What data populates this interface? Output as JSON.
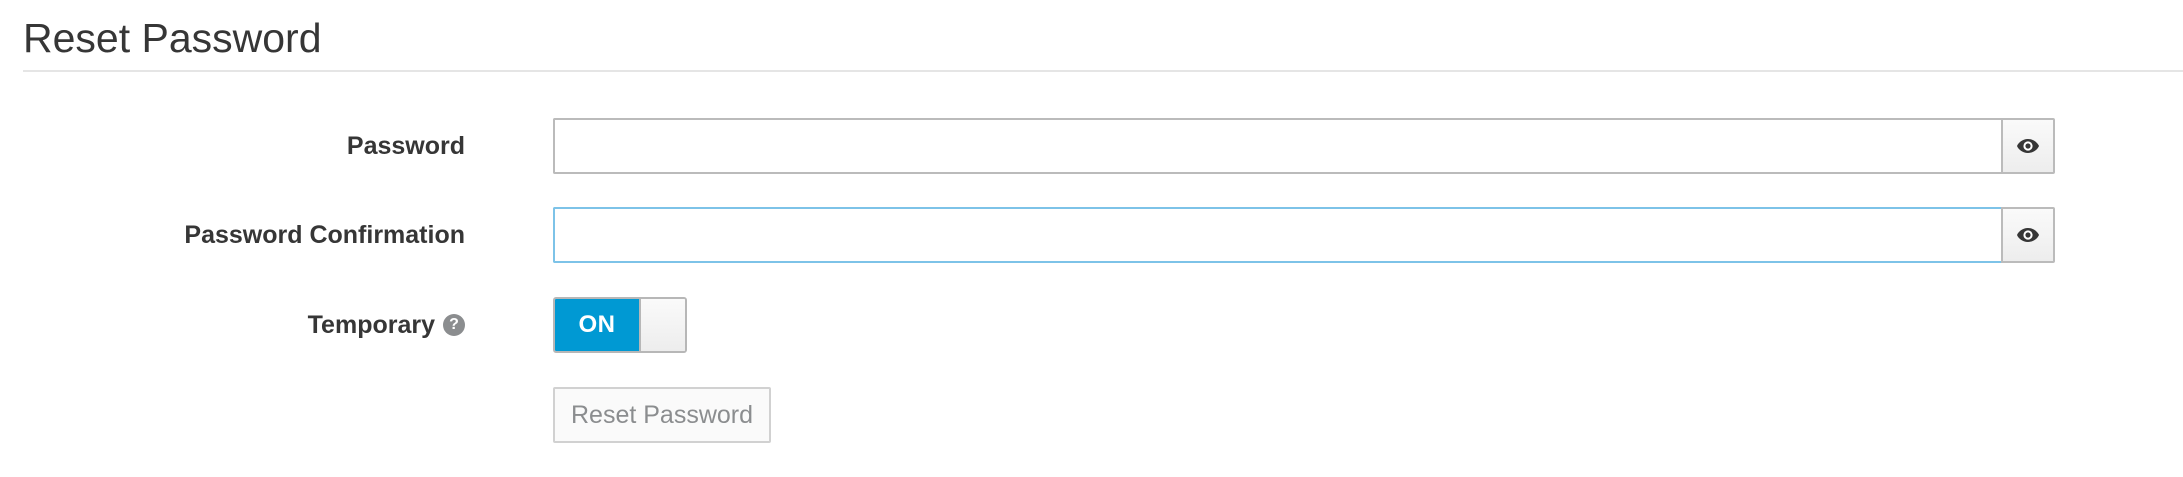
{
  "page": {
    "title": "Reset Password"
  },
  "form": {
    "password": {
      "label": "Password",
      "value": "",
      "placeholder": "",
      "toggle_icon": "eye-icon"
    },
    "password_confirmation": {
      "label": "Password Confirmation",
      "value": "",
      "placeholder": "",
      "toggle_icon": "eye-icon",
      "focused": true
    },
    "temporary": {
      "label": "Temporary",
      "help_icon": "question-circle-icon",
      "switch_label": "ON",
      "state": "on"
    },
    "submit": {
      "label": "Reset Password",
      "disabled": true
    }
  },
  "colors": {
    "switch_on": "#0099d3",
    "focus_border": "#7dc3e8",
    "text": "#363636",
    "muted": "#8b8d8f"
  }
}
